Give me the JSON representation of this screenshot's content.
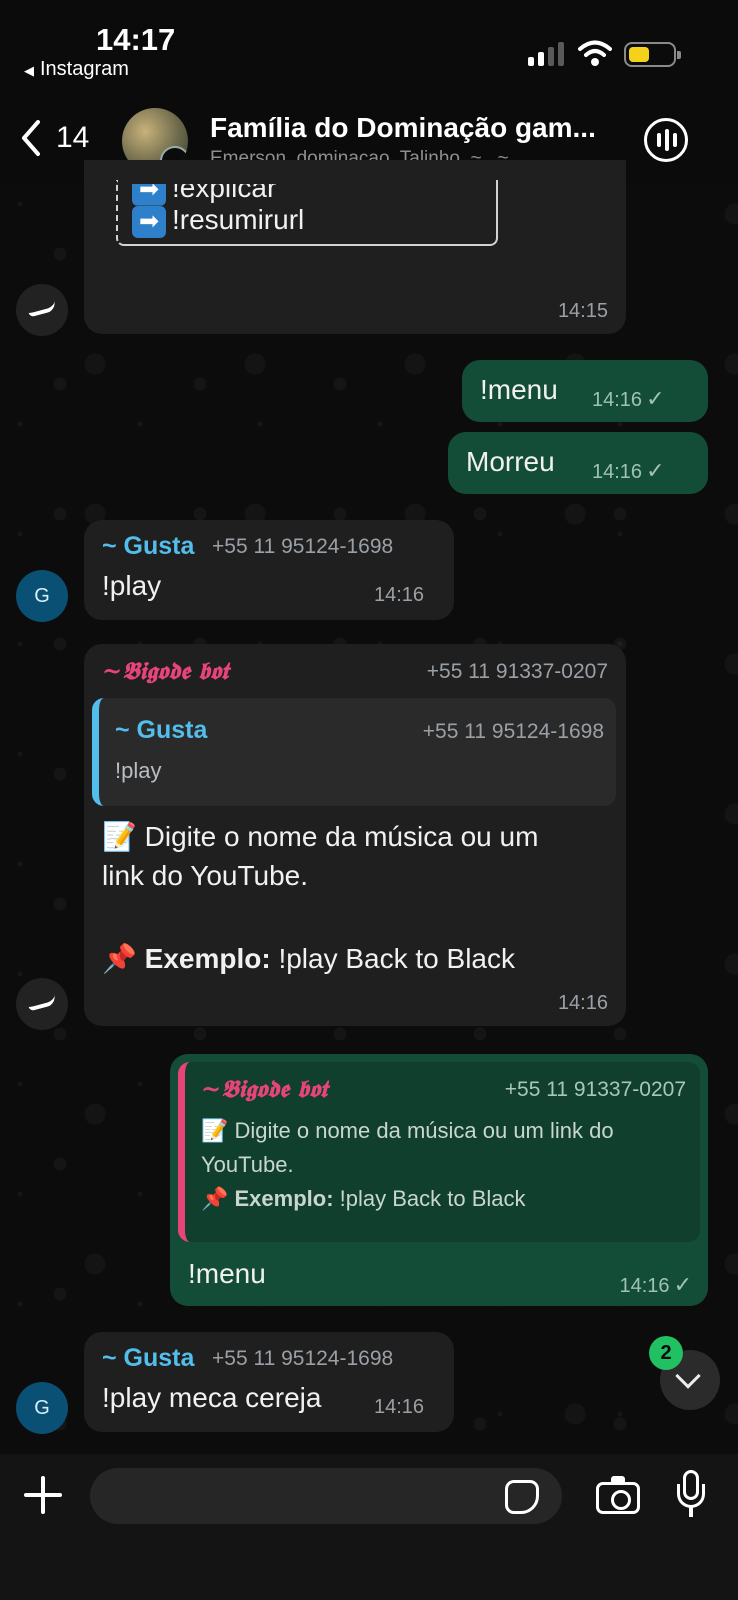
{
  "status_bar": {
    "time": "14:17",
    "back_app": "Instagram"
  },
  "header": {
    "back_count": "14",
    "title": "Família do Dominação gam...",
    "members": "Emerson_dominacao, Talinho, ~., ~.,..."
  },
  "messages": {
    "m1": {
      "partial_line": "!explicar",
      "line": "!resumirurl",
      "time": "14:15"
    },
    "m2": {
      "text": "!menu",
      "time": "14:16"
    },
    "m3": {
      "text": "Morreu",
      "time": "14:16"
    },
    "m4": {
      "sender": "~ Gusta",
      "phone": "+55 11 95124-1698",
      "text": "!play",
      "time": "14:16",
      "avatar_letter": "G"
    },
    "m5": {
      "sender": "~𝕭𝖎𝖌𝖔𝖉𝖊 𝖇𝖔𝖙",
      "phone": "+55 11 91337-0207",
      "quote_sender": "~ Gusta",
      "quote_phone": "+55 11 95124-1698",
      "quote_text": "!play",
      "line1": "📝 Digite o nome da música ou um",
      "line2": "link do YouTube.",
      "example_label": "📌 Exemplo:",
      "example_value": " !play Back to Black",
      "time": "14:16"
    },
    "m6": {
      "quote_sender": "~𝕭𝖎𝖌𝖔𝖉𝖊 𝖇𝖔𝖙",
      "quote_phone": "+55 11 91337-0207",
      "quote_line1": "📝 Digite o nome da música ou um link do",
      "quote_line2": "YouTube.",
      "quote_example_label": "📌 Exemplo:",
      "quote_example_value": " !play Back to Black",
      "text": "!menu",
      "time": "14:16"
    },
    "m7": {
      "sender": "~ Gusta",
      "phone": "+55 11 95124-1698",
      "text": "!play meca cereja",
      "time": "14:16",
      "avatar_letter": "G"
    }
  },
  "scroll_badge": "2",
  "input": {
    "placeholder": ""
  },
  "icons": {
    "back": "chevron-left-icon",
    "call": "group-call-icon",
    "attach": "plus-icon",
    "sticker": "sticker-icon",
    "camera": "camera-icon",
    "mic": "microphone-icon",
    "scroll": "chevron-down-icon"
  },
  "colors": {
    "outgoing_bubble": "#144d37",
    "incoming_bubble": "#1f1f1f",
    "sender_name": "#53bdeb",
    "bot_name": "#e7457a",
    "badge": "#21c063"
  }
}
